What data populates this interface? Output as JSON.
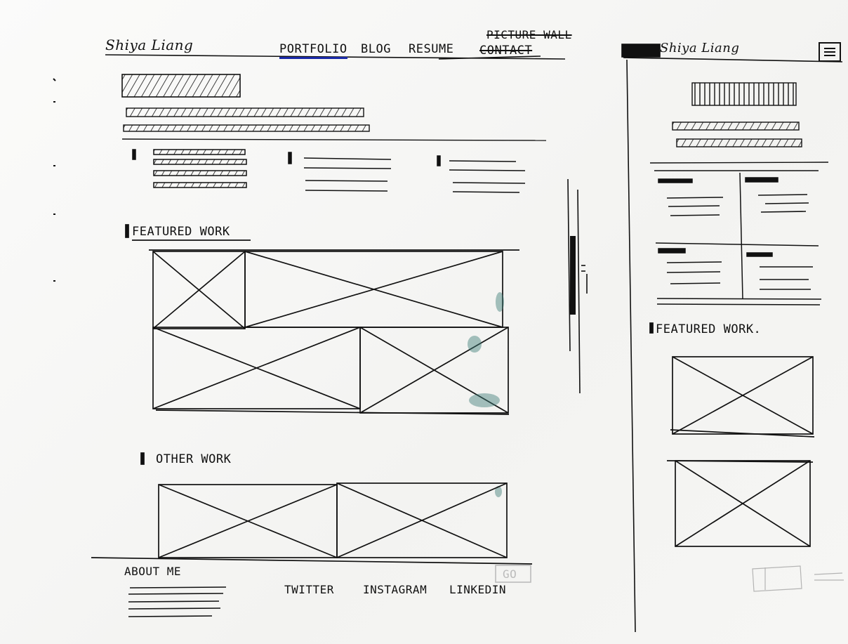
{
  "desktop": {
    "logo": "Shiya Liang",
    "nav": {
      "portfolio": "PORTFOLIO",
      "blog": "BLOG",
      "resume": "RESUME",
      "contact": "CONTACT",
      "picture_wall": "PICTURE WALL"
    },
    "featured_heading": "FEATURED WORK",
    "other_heading": "OTHER WORK",
    "footer": {
      "about": "ABOUT ME",
      "twitter": "TWITTER",
      "instagram": "INSTAGRAM",
      "linkedin": "LINKEDIN",
      "go": "GO"
    }
  },
  "mobile": {
    "logo": "Shiya Liang",
    "menu_icon": "hamburger-menu-icon",
    "featured_heading": "FEATURED WORK."
  },
  "colors": {
    "ink": "#141414",
    "active_underline": "#1a2aa8",
    "ink_bleed": "#3d7d78"
  }
}
